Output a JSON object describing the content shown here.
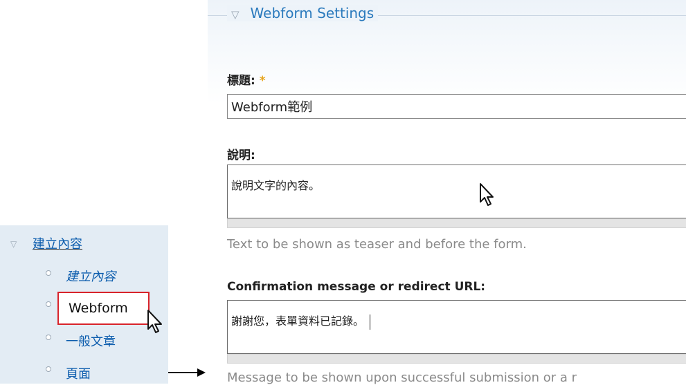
{
  "fieldset": {
    "toggle_icon": "▽",
    "legend": "Webform Settings"
  },
  "title_field": {
    "label": "標題:",
    "required_marker": "*",
    "value": "Webform範例"
  },
  "description_field": {
    "label": "說明:",
    "value": "說明文字的內容。",
    "help": "Text to be shown as teaser and before the form."
  },
  "confirmation_field": {
    "label": "Confirmation message or redirect URL:",
    "value": "謝謝您，表單資料已記錄。",
    "help": "Message to be shown upon successful submission or a r"
  },
  "nav": {
    "toggle_icon": "▽",
    "parent": "建立內容",
    "items": [
      {
        "label": "建立內容",
        "style": "italic-link"
      },
      {
        "label": "Webform",
        "style": "highlighted"
      },
      {
        "label": "一般文章",
        "style": "link"
      },
      {
        "label": "頁面",
        "style": "link"
      }
    ]
  },
  "colors": {
    "link": "#0b5cad",
    "legend": "#2b7abd",
    "highlight_border": "#d8232a",
    "required": "#e6a217",
    "help_text": "#8a8a8a"
  }
}
